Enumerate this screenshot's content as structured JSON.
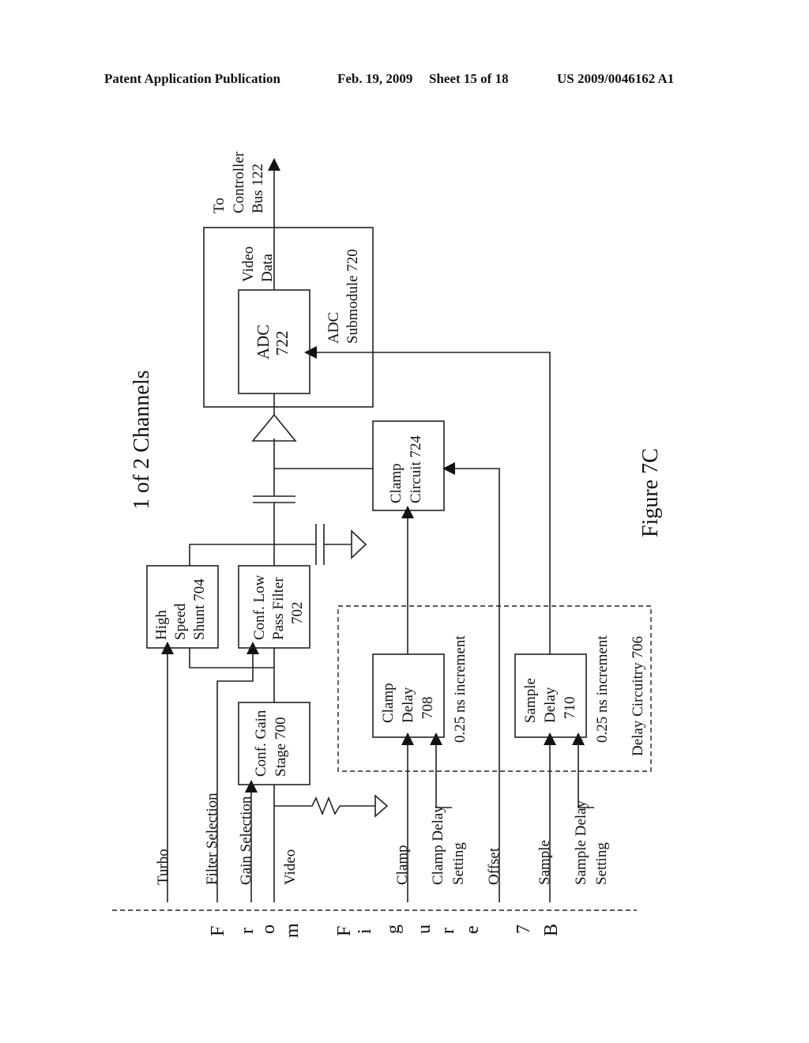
{
  "header": {
    "publication": "Patent Application Publication",
    "date": "Feb. 19, 2009",
    "sheet": "Sheet 15 of 18",
    "number": "US 2009/0046162 A1"
  },
  "figure": {
    "title": "1 of 2 Channels",
    "label": "Figure 7C",
    "from_label_letters": [
      "F",
      "r",
      "o",
      "m",
      "F",
      "i",
      "g",
      "u",
      "r",
      "e",
      "7",
      "B"
    ]
  },
  "inputs": {
    "turbo": "Turbo",
    "filter_selection": "Filter Selection",
    "gain_selection": "Gain Selection",
    "video": "Video",
    "clamp": "Clamp",
    "clamp_delay_setting_1": "Clamp Delay",
    "clamp_delay_setting_2": "Setting",
    "offset": "Offset",
    "sample": "Sample",
    "sample_delay_setting_1": "Sample Delay",
    "sample_delay_setting_2": "Setting"
  },
  "blocks": {
    "gain_stage": [
      "Conf. Gain",
      "Stage 700"
    ],
    "low_pass": [
      "Conf. Low",
      "Pass Filter",
      "702"
    ],
    "shunt": [
      "High",
      "Speed",
      "Shunt 704"
    ],
    "clamp_delay": [
      "Clamp",
      "Delay",
      "708"
    ],
    "sample_delay": [
      "Sample",
      "Delay",
      "710"
    ],
    "clamp_circuit": [
      "Clamp",
      "Circuit 724"
    ],
    "adc": [
      "ADC",
      "722"
    ],
    "adc_submodule": [
      "ADC",
      "Submodule 720"
    ],
    "delay_circuitry": "Delay Circuitry 706",
    "increment_clamp": "0.25 ns increment",
    "increment_sample": "0.25 ns increment",
    "video_data": [
      "Video",
      "Data"
    ],
    "to_controller": [
      "To",
      "Controller",
      "Bus 122"
    ]
  }
}
